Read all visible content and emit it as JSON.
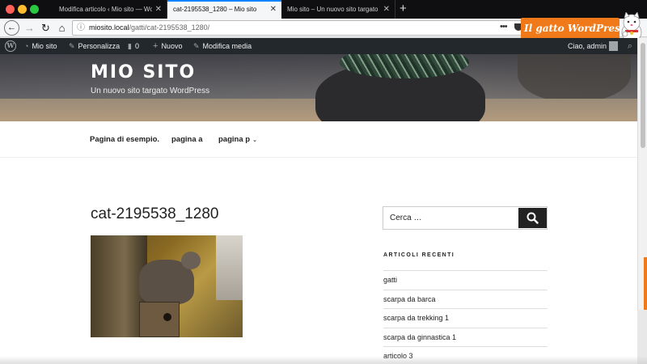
{
  "browser": {
    "tabs": [
      {
        "title": "Modifica articolo ‹ Mio sito — Word",
        "active": false
      },
      {
        "title": "cat-2195538_1280 – Mio sito",
        "active": true
      },
      {
        "title": "Mio sito – Un nuovo sito targato Wo",
        "active": false
      }
    ],
    "new_tab_glyph": "+",
    "url_host": "miosito.local",
    "url_path": "/gatti/cat-2195538_1280/",
    "url_dots": "•••",
    "icons": [
      "back-icon",
      "forward-icon",
      "reload-icon",
      "home-icon",
      "info-icon",
      "pocket-icon"
    ]
  },
  "logo_banner": {
    "text": "Il gatto WordPress",
    "color": "#f07a1a"
  },
  "adminbar": {
    "site_name": "Mio sito",
    "customize": "Personalizza",
    "comments_count": "0",
    "new_label": "Nuovo",
    "edit_media": "Modifica media",
    "greeting": "Ciao, admin"
  },
  "site": {
    "title": "MIO SITO",
    "description": "Un nuovo sito targato WordPress"
  },
  "nav": {
    "items": [
      {
        "label": "Pagina di esempio."
      },
      {
        "label": "pagina a"
      },
      {
        "label": "pagina p"
      }
    ]
  },
  "post": {
    "title": "cat-2195538_1280"
  },
  "sidebar": {
    "search_placeholder": "Cerca …",
    "recent_title": "ARTICOLI RECENTI",
    "recent_posts": [
      "gatti",
      "scarpa da barca",
      "scarpa da trekking 1",
      "scarpa da ginnastica 1",
      "articolo 3"
    ]
  }
}
